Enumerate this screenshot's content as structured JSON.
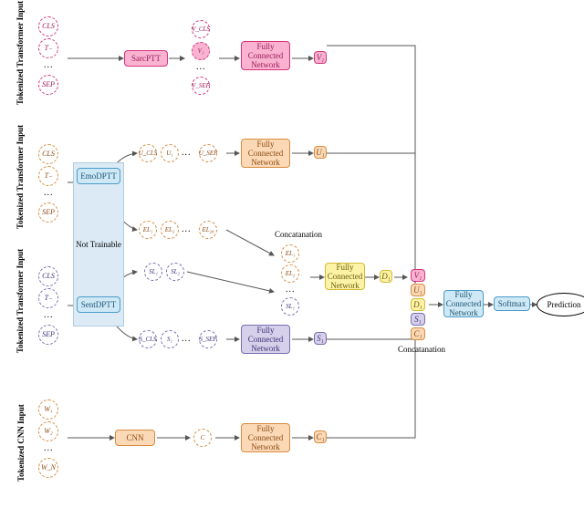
{
  "diagram": {
    "branches": {
      "sarc": {
        "input_label": "Tokenized Transformer Input",
        "tokens": [
          "CLS",
          "T₋",
          "...",
          "SEP"
        ],
        "block": "SarcPTT",
        "seq": [
          "V_CLS",
          "V₁",
          "...",
          "V_SEP"
        ],
        "fcn": "Fully Connected Network",
        "out": "V₁"
      },
      "emo": {
        "input_label": "Tokenized Transformer Input",
        "tokens": [
          "CLS",
          "T₋",
          "...",
          "SEP"
        ],
        "block": "EmoDPTT",
        "seq_top": [
          "U_CLS",
          "U₁",
          "...",
          "U_SEP"
        ],
        "fcn_top": "Fully Connected Network",
        "out_top": "U₁",
        "seq_logits": [
          "EL₁",
          "EL₂",
          "...",
          "EL₂₈"
        ]
      },
      "sent": {
        "input_label": "Tokenized Transformer Input",
        "tokens": [
          "CLS",
          "T₋",
          "...",
          "SEP"
        ],
        "block": "SentDPTT",
        "seq_logits": [
          "SL₁",
          "SL₂"
        ],
        "seq_bot": [
          "S_CLS",
          "S₁",
          "...",
          "S_SEP"
        ],
        "fcn_bot": "Fully Connected Network",
        "out_bot": "S₁"
      },
      "cnn": {
        "input_label": "Tokenized CNN Input",
        "tokens": [
          "W₁",
          "W₂",
          "...",
          "W_N"
        ],
        "block": "CNN",
        "mid": "C",
        "fcn": "Fully Connected Network",
        "out": "C₁"
      }
    },
    "not_trainable": "Not Trainable",
    "concat_mid": {
      "label": "Concatanation",
      "items": [
        "EL₁",
        "EL₂",
        "...",
        "SL₁"
      ],
      "fcn": "Fully Connected Network",
      "out": "D₁"
    },
    "final": {
      "concat_label": "Concatanation",
      "items": [
        "V₁",
        "U₁",
        "D₁",
        "S₁",
        "C₁"
      ],
      "fcn": "Fully Connected Network",
      "softmax": "Softmax",
      "prediction": "Prediction"
    }
  }
}
